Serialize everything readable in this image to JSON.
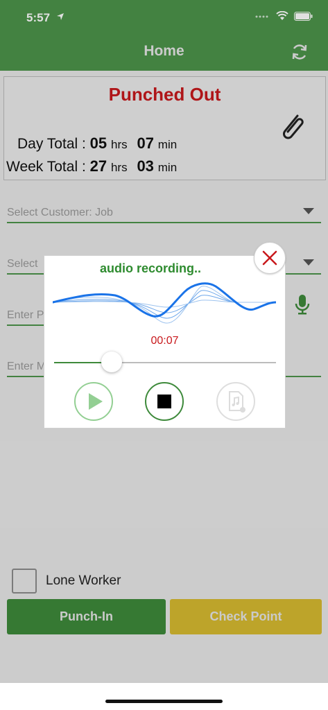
{
  "status_bar": {
    "time": "5:57"
  },
  "navbar": {
    "title": "Home"
  },
  "summary": {
    "status": "Punched Out",
    "day_label": "Day Total :",
    "day_hours": "05",
    "day_minutes": "07",
    "week_label": "Week Total :",
    "week_hours": "27",
    "week_minutes": "03",
    "hrs_unit": "hrs",
    "min_unit": "min"
  },
  "form": {
    "customer_placeholder": "Select Customer: Job",
    "second_placeholder": "Select",
    "third_placeholder": "Enter P",
    "fourth_placeholder": "Enter M"
  },
  "dialog": {
    "title": "audio recording..",
    "timer": "00:07",
    "progress_fraction": 0.26
  },
  "footer": {
    "lone_worker_label": "Lone Worker",
    "punch_in_label": "Punch-In",
    "check_point_label": "Check Point"
  },
  "colors": {
    "brand_green": "#4d944a",
    "status_red": "#c8181c",
    "checkpoint_yellow": "#d8bb30",
    "wave_blue": "#1a73e8"
  },
  "icons": [
    "location-arrow-icon",
    "signal-icon",
    "wifi-icon",
    "battery-icon",
    "refresh-icon",
    "paperclip-icon",
    "microphone-icon",
    "close-icon",
    "play-icon",
    "stop-icon",
    "audio-file-icon",
    "chevron-down-icon"
  ]
}
